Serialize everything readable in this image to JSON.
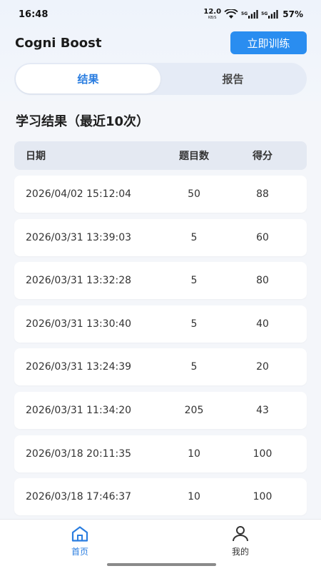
{
  "status_bar": {
    "time": "16:48",
    "net_speed_value": "12.0",
    "net_speed_unit": "KB/S",
    "sim1_label": "5G",
    "sim2_label": "5G",
    "battery": "57%"
  },
  "header": {
    "app_title": "Cogni Boost",
    "train_button": "立即训练"
  },
  "tabs": [
    {
      "label": "结果",
      "active": true
    },
    {
      "label": "报告",
      "active": false
    }
  ],
  "results": {
    "title": "学习结果（最近10次）",
    "columns": {
      "date": "日期",
      "count": "题目数",
      "score": "得分"
    },
    "rows": [
      {
        "date": "2026/04/02 15:12:04",
        "count": "50",
        "score": "88"
      },
      {
        "date": "2026/03/31 13:39:03",
        "count": "5",
        "score": "60"
      },
      {
        "date": "2026/03/31 13:32:28",
        "count": "5",
        "score": "80"
      },
      {
        "date": "2026/03/31 13:30:40",
        "count": "5",
        "score": "40"
      },
      {
        "date": "2026/03/31 13:24:39",
        "count": "5",
        "score": "20"
      },
      {
        "date": "2026/03/31 11:34:20",
        "count": "205",
        "score": "43"
      },
      {
        "date": "2026/03/18 20:11:35",
        "count": "10",
        "score": "100"
      },
      {
        "date": "2026/03/18 17:46:37",
        "count": "10",
        "score": "100"
      }
    ]
  },
  "bottom_nav": {
    "home": {
      "label": "首页",
      "icon": "home-icon"
    },
    "mine": {
      "label": "我的",
      "icon": "user-icon"
    }
  },
  "colors": {
    "accent": "#2a8df0",
    "active_tab_text": "#2a7de0"
  }
}
